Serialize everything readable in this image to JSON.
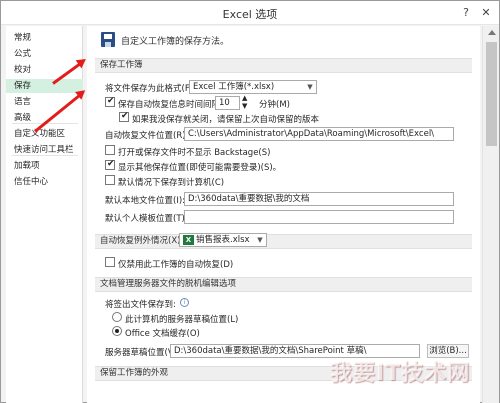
{
  "window": {
    "title": "Excel 选项",
    "help": "?",
    "close": "✕"
  },
  "sidebar": {
    "items": [
      "常规",
      "公式",
      "校对",
      "保存",
      "语言",
      "高级",
      "自定义功能区",
      "快速访问工具栏",
      "加载项",
      "信任中心"
    ],
    "active": "保存"
  },
  "header": {
    "title": "自定义工作簿的保存方法。"
  },
  "save_workbooks": {
    "section_title": "保存工作簿",
    "format_label": "将文件保存为此格式(F):",
    "format_value": "Excel 工作簿(*.xlsx)",
    "autorecover_label": "保存自动恢复信息时间间隔(A)",
    "autorecover_value": "10",
    "minutes_label": "分钟(M)",
    "keep_last_label": "如果我没保存就关闭，请保留上次自动保留的版本",
    "autorecover_path_label": "自动恢复文件位置(R):",
    "autorecover_path_value": "C:\\Users\\Administrator\\AppData\\Roaming\\Microsoft\\Excel\\",
    "backstage_label": "打开或保存文件时不显示 Backstage(S)",
    "show_locations_label": "显示其他保存位置(即使可能需要登录)(S)。",
    "save_computer_label": "默认情况下保存到计算机(C)",
    "local_location_label": "默认本地文件位置(I):",
    "local_location_value": "D:\\360data\\重要数据\\我的文档",
    "template_location_label": "默认个人模板位置(T):"
  },
  "autorecover_exceptions": {
    "section_title": "自动恢复例外情况(X):",
    "file_value": "销售报表.xlsx",
    "disable_label": "仅禁用此工作簿的自动恢复(D)"
  },
  "offline_editing": {
    "section_title": "文档管理服务器文件的脱机编辑选项",
    "save_to_label": "将签出文件保存到:",
    "option_server": "此计算机的服务器草稿位置(L)",
    "option_cache": "Office 文档缓存(O)",
    "drafts_label": "服务器草稿位置(V):",
    "drafts_value": "D:\\360data\\重要数据\\我的文档\\SharePoint 草稿\\",
    "browse_label": "浏览(B)..."
  },
  "preserve_section": {
    "section_title": "保留工作簿的外观"
  },
  "watermark": {
    "main": "我要IT技术网",
    "sub": "www.52it.com"
  },
  "colors": {
    "active_nav": "#d3f0e0",
    "arrow": "#e31b1b",
    "excel_green": "#1f7a3c"
  }
}
